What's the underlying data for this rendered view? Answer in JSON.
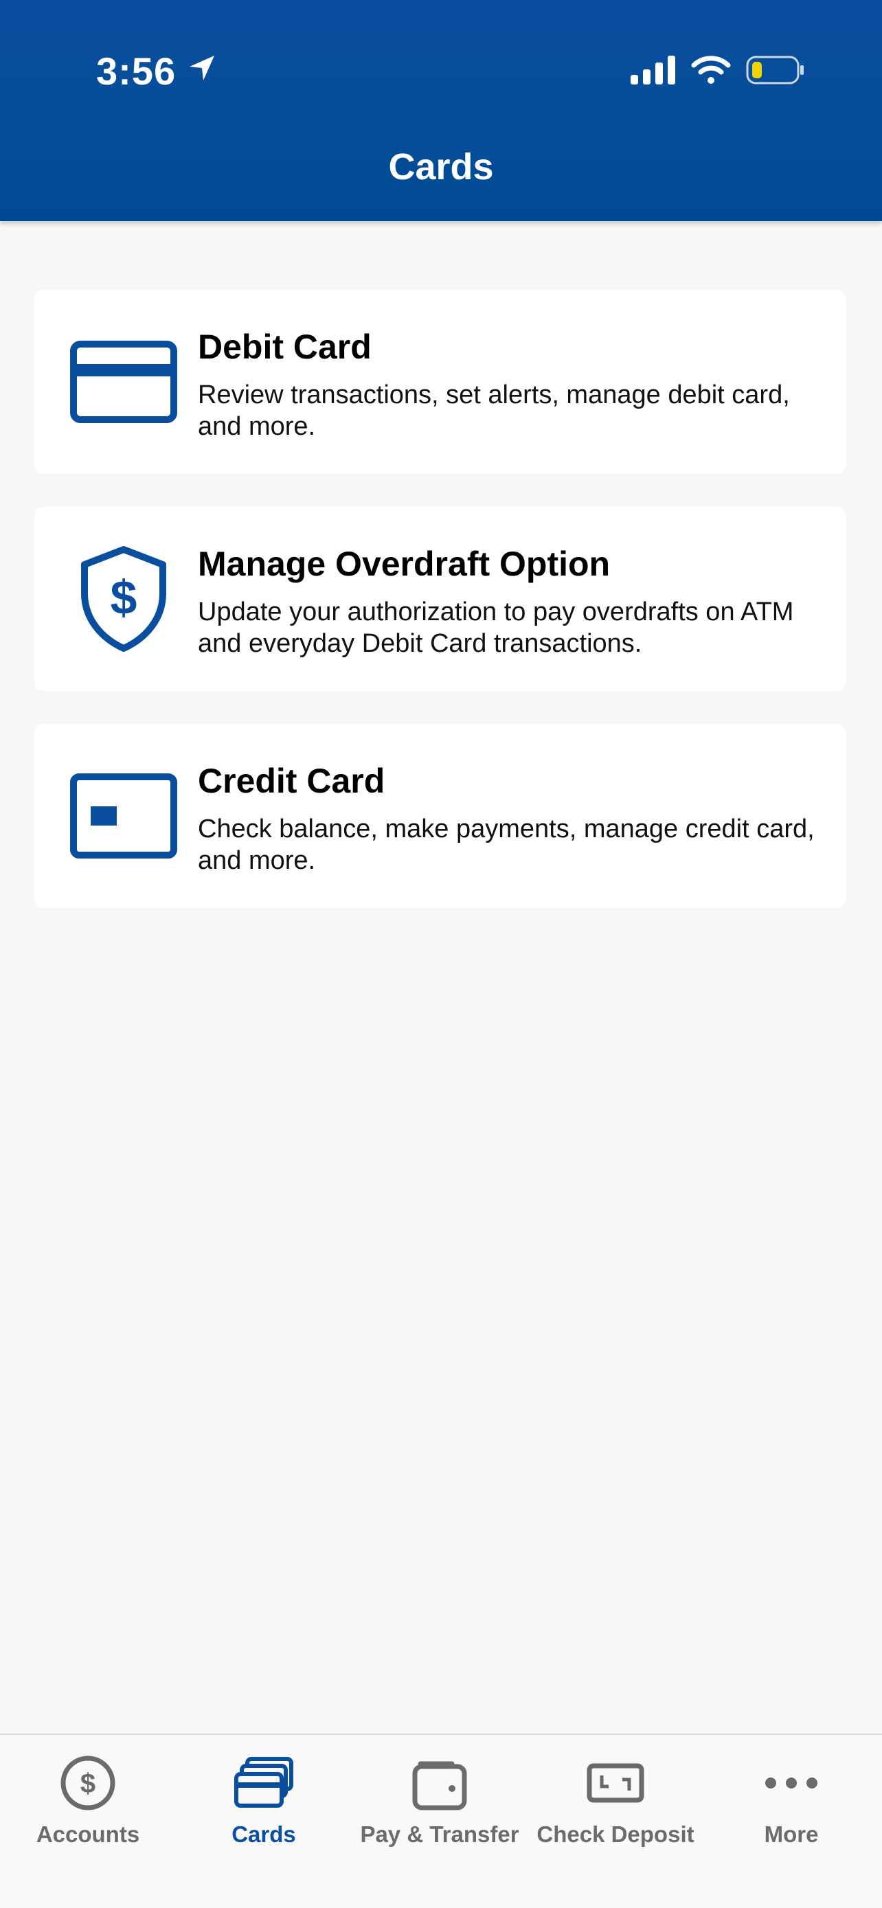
{
  "status_bar": {
    "time": "3:56",
    "icons": [
      "location-arrow-icon",
      "cellular-signal-icon",
      "wifi-icon",
      "battery-icon"
    ]
  },
  "header": {
    "title": "Cards"
  },
  "menu": {
    "items": [
      {
        "icon": "debit-card-icon",
        "title": "Debit Card",
        "description": "Review transactions, set alerts, manage debit card, and more."
      },
      {
        "icon": "shield-dollar-icon",
        "title": "Manage Overdraft Option",
        "description": "Update your authorization to pay overdrafts on ATM and everyday Debit Card transactions."
      },
      {
        "icon": "credit-card-icon",
        "title": "Credit Card",
        "description": "Check balance, make payments, manage credit card, and more."
      }
    ]
  },
  "tabbar": {
    "active_tab": "Cards",
    "tabs": [
      {
        "label": "Accounts",
        "icon": "dollar-circle-icon"
      },
      {
        "label": "Cards",
        "icon": "stacked-cards-icon"
      },
      {
        "label": "Pay & Transfer",
        "icon": "wallet-icon"
      },
      {
        "label": "Check Deposit",
        "icon": "check-scan-icon"
      },
      {
        "label": "More",
        "icon": "more-dots-icon"
      }
    ]
  },
  "colors": {
    "brand_blue": "#0a4f9f",
    "tab_inactive": "#6b6b6b",
    "battery_low": "#f2d200"
  }
}
